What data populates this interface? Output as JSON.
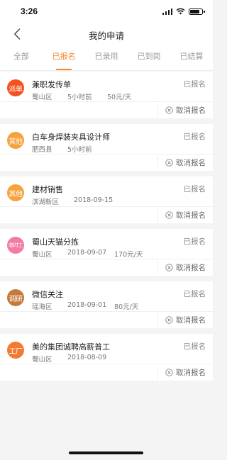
{
  "status_bar": {
    "time": "3:26",
    "battery_level": 0.85
  },
  "nav": {
    "title": "我的申请",
    "back_icon": "chevron-left-icon"
  },
  "tabs": [
    {
      "label": "全部",
      "active": false
    },
    {
      "label": "已报名",
      "active": true
    },
    {
      "label": "已录用",
      "active": false
    },
    {
      "label": "已到岗",
      "active": false
    },
    {
      "label": "已结算",
      "active": false
    }
  ],
  "colors": {
    "accent": "#f7852a"
  },
  "applications": [
    {
      "badge": "派单",
      "badge_color": "#f4511e",
      "title": "兼职发传单",
      "status": "已报名",
      "meta": [
        "蜀山区",
        "5小时前",
        "50元/天"
      ],
      "action": "取消报名"
    },
    {
      "badge": "其他",
      "badge_color": "#f7a23c",
      "title": "白车身焊装夹具设计师",
      "status": "已报名",
      "meta": [
        "肥西县",
        "5小时前"
      ],
      "action": "取消报名"
    },
    {
      "badge": "其他",
      "badge_color": "#f7a23c",
      "title": "建材销售",
      "status": "已报名",
      "meta": [
        "滨湖新区",
        "2018-09-15"
      ],
      "action": "取消报名"
    },
    {
      "badge": "临时工",
      "badge_color": "#f27ba5",
      "title": "蜀山天猫分拣",
      "status": "已报名",
      "meta": [
        "蜀山区",
        "2018-09-07",
        "170元/天"
      ],
      "action": "取消报名"
    },
    {
      "badge": "调研",
      "badge_color": "#c47a3a",
      "title": "微信关注",
      "status": "已报名",
      "meta": [
        "瑶海区",
        "2018-09-01",
        "80元/天"
      ],
      "action": "取消报名"
    },
    {
      "badge": "工厂",
      "badge_color": "#f47a32",
      "title": "美的集团诚聘高薪普工",
      "status": "已报名",
      "meta": [
        "蜀山区",
        "2018-08-09"
      ],
      "action": "取消报名"
    }
  ]
}
